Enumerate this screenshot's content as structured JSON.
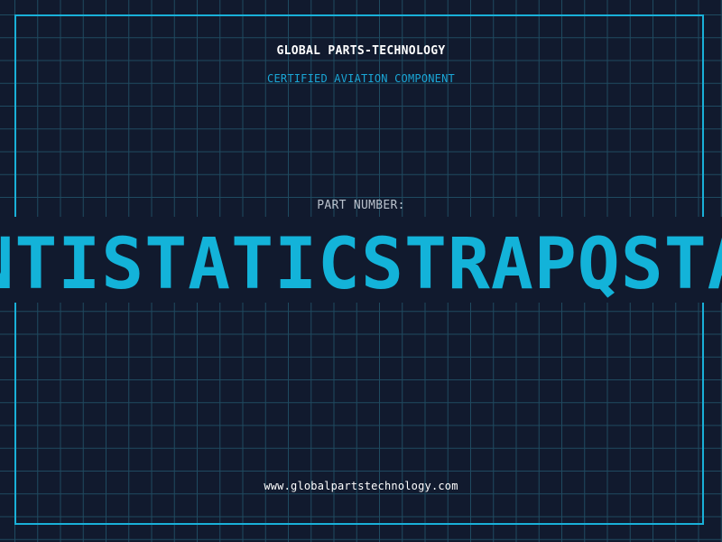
{
  "header": {
    "company": "GLOBAL PARTS-TECHNOLOGY",
    "subtitle": "CERTIFIED AVIATION COMPONENT"
  },
  "part": {
    "label": "PART NUMBER:",
    "number": "NTISTATICSTRAPQSTA"
  },
  "footer": {
    "website": "www.globalpartstechnology.com"
  },
  "colors": {
    "background": "#111a2e",
    "grid": "#1f4a60",
    "accent": "#13b3d9",
    "frame": "#19b0d8"
  }
}
